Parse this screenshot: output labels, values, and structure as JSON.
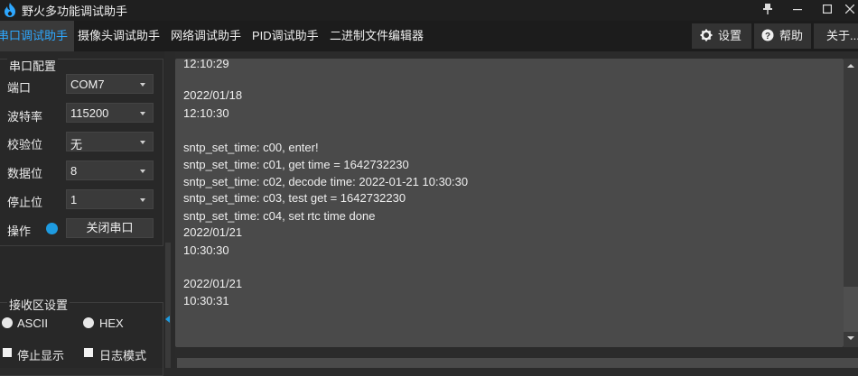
{
  "window": {
    "title": "野火多功能调试助手",
    "pin_icon": "pin-icon",
    "minimize_icon": "minimize-icon",
    "maximize_icon": "maximize-icon",
    "close_icon": "close-icon"
  },
  "tabs": [
    {
      "label": "串口调试助手",
      "active": true
    },
    {
      "label": "摄像头调试助手",
      "active": false
    },
    {
      "label": "网络调试助手",
      "active": false
    },
    {
      "label": "PID调试助手",
      "active": false
    },
    {
      "label": "二进制文件编辑器",
      "active": false
    }
  ],
  "toolbar": {
    "settings_label": "设置",
    "settings_icon": "gear-icon",
    "help_label": "帮助",
    "help_icon": "help-icon",
    "about_label": "关于..."
  },
  "serial_config": {
    "group_title": "串口配置",
    "port_label": "端口",
    "port_value": "COM7",
    "baud_label": "波特率",
    "baud_value": "115200",
    "parity_label": "校验位",
    "parity_value": "无",
    "databits_label": "数据位",
    "databits_value": "8",
    "stopbits_label": "停止位",
    "stopbits_value": "1",
    "operation_label": "操作",
    "close_port_button": "关闭串口",
    "status_color": "#1e9be0"
  },
  "receive_settings": {
    "group_title": "接收区设置",
    "ascii_label": "ASCII",
    "ascii_selected": true,
    "hex_label": "HEX",
    "hex_selected": true,
    "stop_display_label": "停止显示",
    "log_mode_label": "日志模式"
  },
  "receive_log": [
    "12:10:29",
    "",
    "2022/01/18",
    "12:10:30",
    "",
    "sntp_set_time: c00, enter!",
    "sntp_set_time: c01, get time = 1642732230",
    "sntp_set_time: c02, decode time: 2022-01-21 10:30:30",
    "sntp_set_time: c03, test get = 1642732230",
    "sntp_set_time: c04, set rtc time done",
    "2022/01/21",
    "10:30:30",
    "",
    "2022/01/21",
    "10:30:31"
  ],
  "colors": {
    "accent": "#2ea8ff",
    "background": "#2b2b2b",
    "receive_area": "#4a4a4a"
  }
}
